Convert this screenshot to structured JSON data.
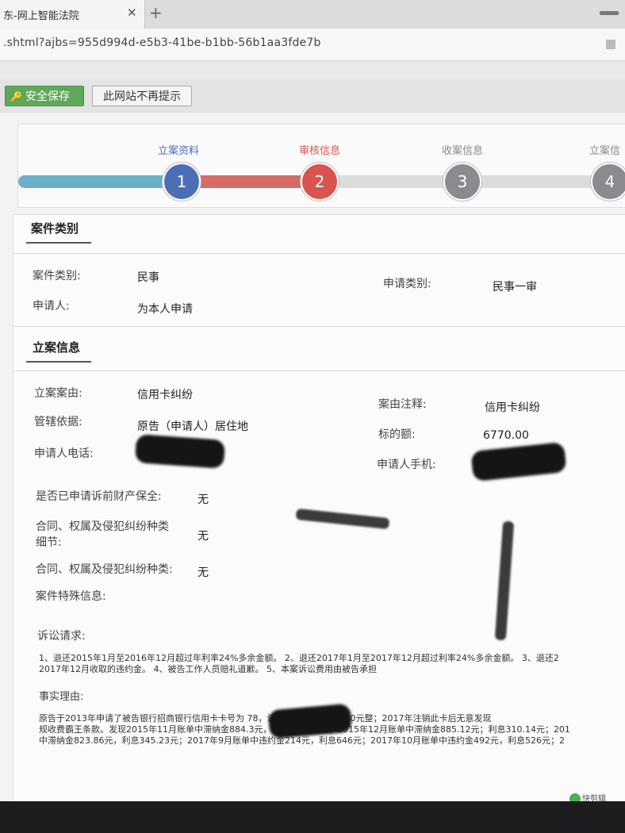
{
  "browser": {
    "tab_title": "东-网上智能法院",
    "tab_close": "✕",
    "tab_new": "+",
    "url": ".shtml?ajbs=955d994d-e5b3-41be-b1bb-56b1aa3fde7b"
  },
  "notification": {
    "save_label": "安全保存",
    "dismiss_label": "此网站不再提示"
  },
  "steps": [
    {
      "number": "1",
      "label": "立案资料",
      "state": "done"
    },
    {
      "number": "2",
      "label": "审核信息",
      "state": "current"
    },
    {
      "number": "3",
      "label": "收案信息",
      "state": "pending"
    },
    {
      "number": "4",
      "label": "立案信",
      "state": "pending"
    }
  ],
  "colors": {
    "step_done": "#4a6fb5",
    "step_current": "#d9534f",
    "step_pending": "#8a8a8f",
    "bar_done": "#6bb0c6",
    "bar_current": "#d66a68",
    "bar_pending": "#dcdcdc"
  },
  "case_category": {
    "title": "案件类别",
    "type_label": "案件类别:",
    "type_value": "民事",
    "applicant_label": "申请人:",
    "applicant_value": "为本人申请",
    "apply_type_label": "申请类别:",
    "apply_type_value": "民事一审"
  },
  "filing_info": {
    "title": "立案信息",
    "cause_label": "立案案由:",
    "cause_value": "信用卡纠纷",
    "jurisdiction_label": "管辖依据:",
    "jurisdiction_value": "原告（申请人）居住地",
    "phone_label": "申请人电话:",
    "note_label": "案由注释:",
    "note_value": "信用卡纠纷",
    "amount_label": "标的额:",
    "amount_value": "6770.00",
    "mobile_label": "申请人手机:",
    "preservation_label": "是否已申请诉前财产保全:",
    "preservation_value": "无",
    "contract_detail_label_1": "合同、权属及侵犯纠纷种类",
    "contract_detail_label_2": "细节:",
    "contract_detail_value": "无",
    "contract_type_label": "合同、权属及侵犯纠纷种类:",
    "contract_type_value": "无",
    "special_label": "案件特殊信息:",
    "claims_label": "诉讼请求:",
    "claims_line1": "1、退还2015年1月至2016年12月超过年利率24%多余金额。 2、退还2017年1月至2017年12月超过利率24%多余金额。 3、退还2",
    "claims_line2": "2017年12月收取的违约金。 4、被告工作人员赔礼道歉。 5、本案诉讼费用由被告承担",
    "facts_label": "事实理由:",
    "facts_line1": "原告于2013年申请了被告银行招商银行信用卡卡号为              78，该卡授信额度为30000元整；2017年注销此卡后无意发现",
    "facts_line2": "规收费霸王条款。发现2015年11月账单中滞纳金884.3元，利息279.61元；2015年12月账单中滞纳金885.12元；利息310.14元；201",
    "facts_line3": "中滞纳金823.86元，利息345.23元；2017年9月账单中违约金214元，利息646元；2017年10月账单中违约金492元，利息526元；2"
  },
  "status_bar": {
    "text": "快剪辑"
  }
}
